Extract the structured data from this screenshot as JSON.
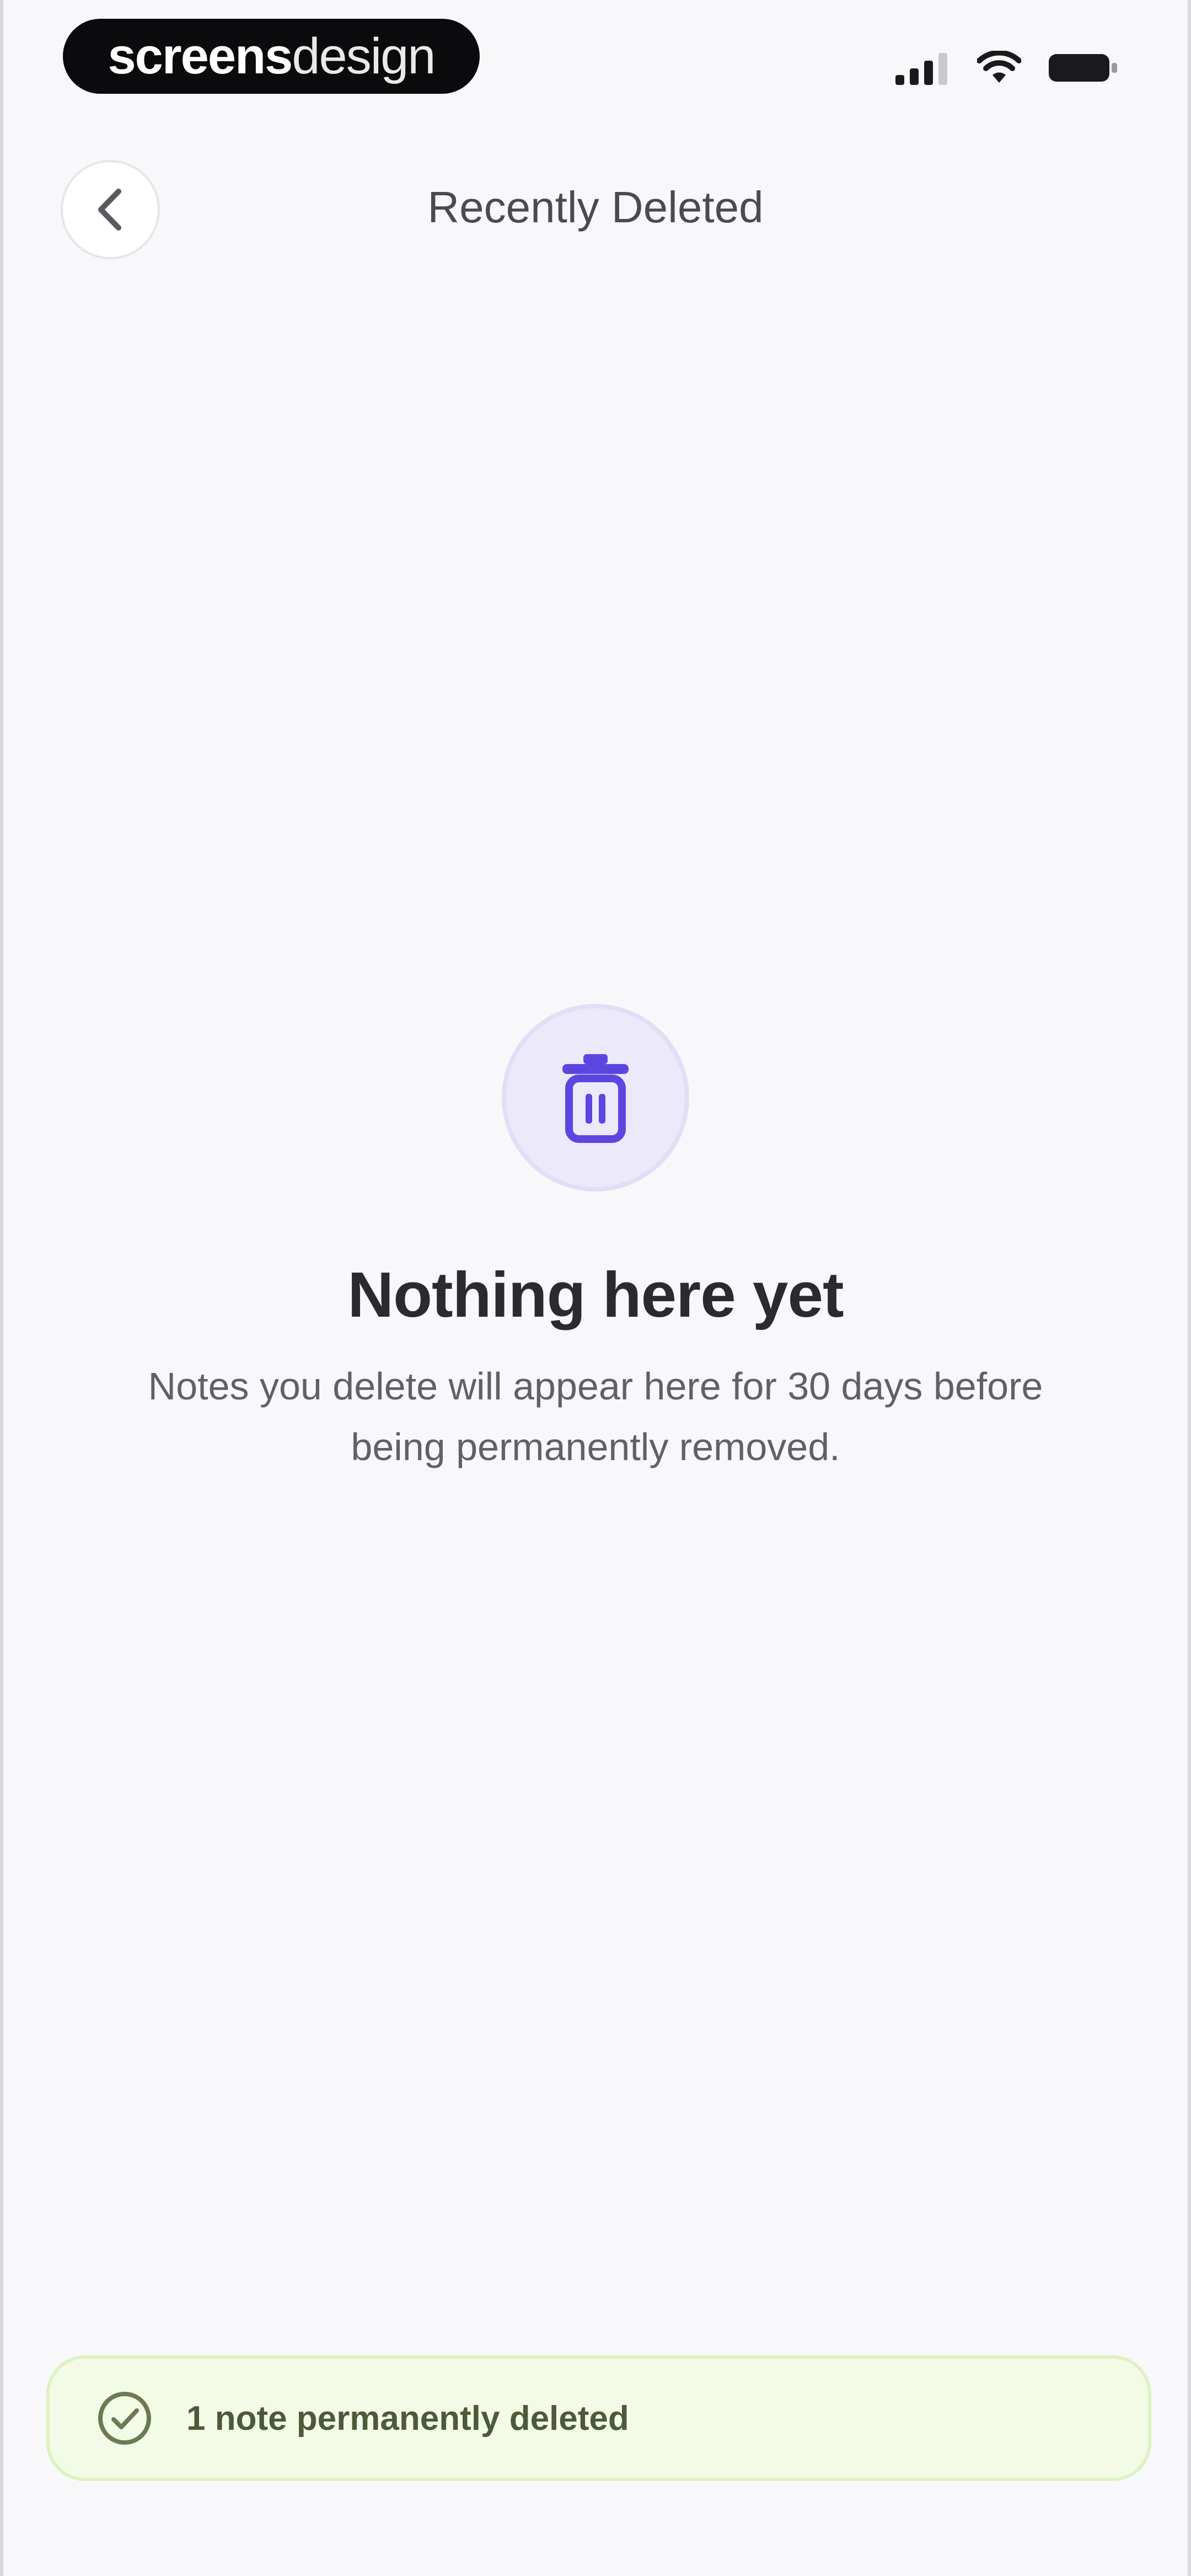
{
  "status_bar": {
    "brand_strong": "screens",
    "brand_light": "design",
    "icons": [
      "signal-icon",
      "wifi-icon",
      "battery-icon"
    ]
  },
  "header": {
    "back_icon": "chevron-left-icon",
    "title": "Recently Deleted"
  },
  "empty_state": {
    "icon": "trash-icon",
    "title": "Nothing here yet",
    "subtitle": "Notes you delete will appear here for 30 days before being permanently removed."
  },
  "toast": {
    "icon": "check-circle-icon",
    "message": "1 note permanently deleted"
  },
  "colors": {
    "background": "#f8f8fa",
    "accent": "#5b47e0",
    "accent_soft": "#ece9fb",
    "toast_bg": "#f3fbe7",
    "toast_border": "#ddf2c2"
  }
}
